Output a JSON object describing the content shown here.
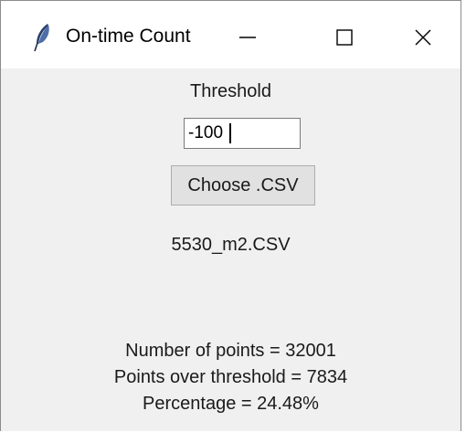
{
  "window": {
    "title": "On-time Count",
    "controls": {
      "minimize": "minimize",
      "maximize": "maximize",
      "close": "close"
    }
  },
  "threshold": {
    "label": "Threshold",
    "value": "-100"
  },
  "choose_button": {
    "label": "Choose .CSV"
  },
  "file": {
    "name": "5530_m2.CSV"
  },
  "results": {
    "number_of_points": "Number of points = 32001",
    "points_over_threshold": "Points over threshold = 7834",
    "percentage": "Percentage = 24.48%"
  },
  "icons": {
    "app": "feather-icon",
    "minimize": "minimize-icon",
    "maximize": "maximize-icon",
    "close": "close-icon"
  }
}
